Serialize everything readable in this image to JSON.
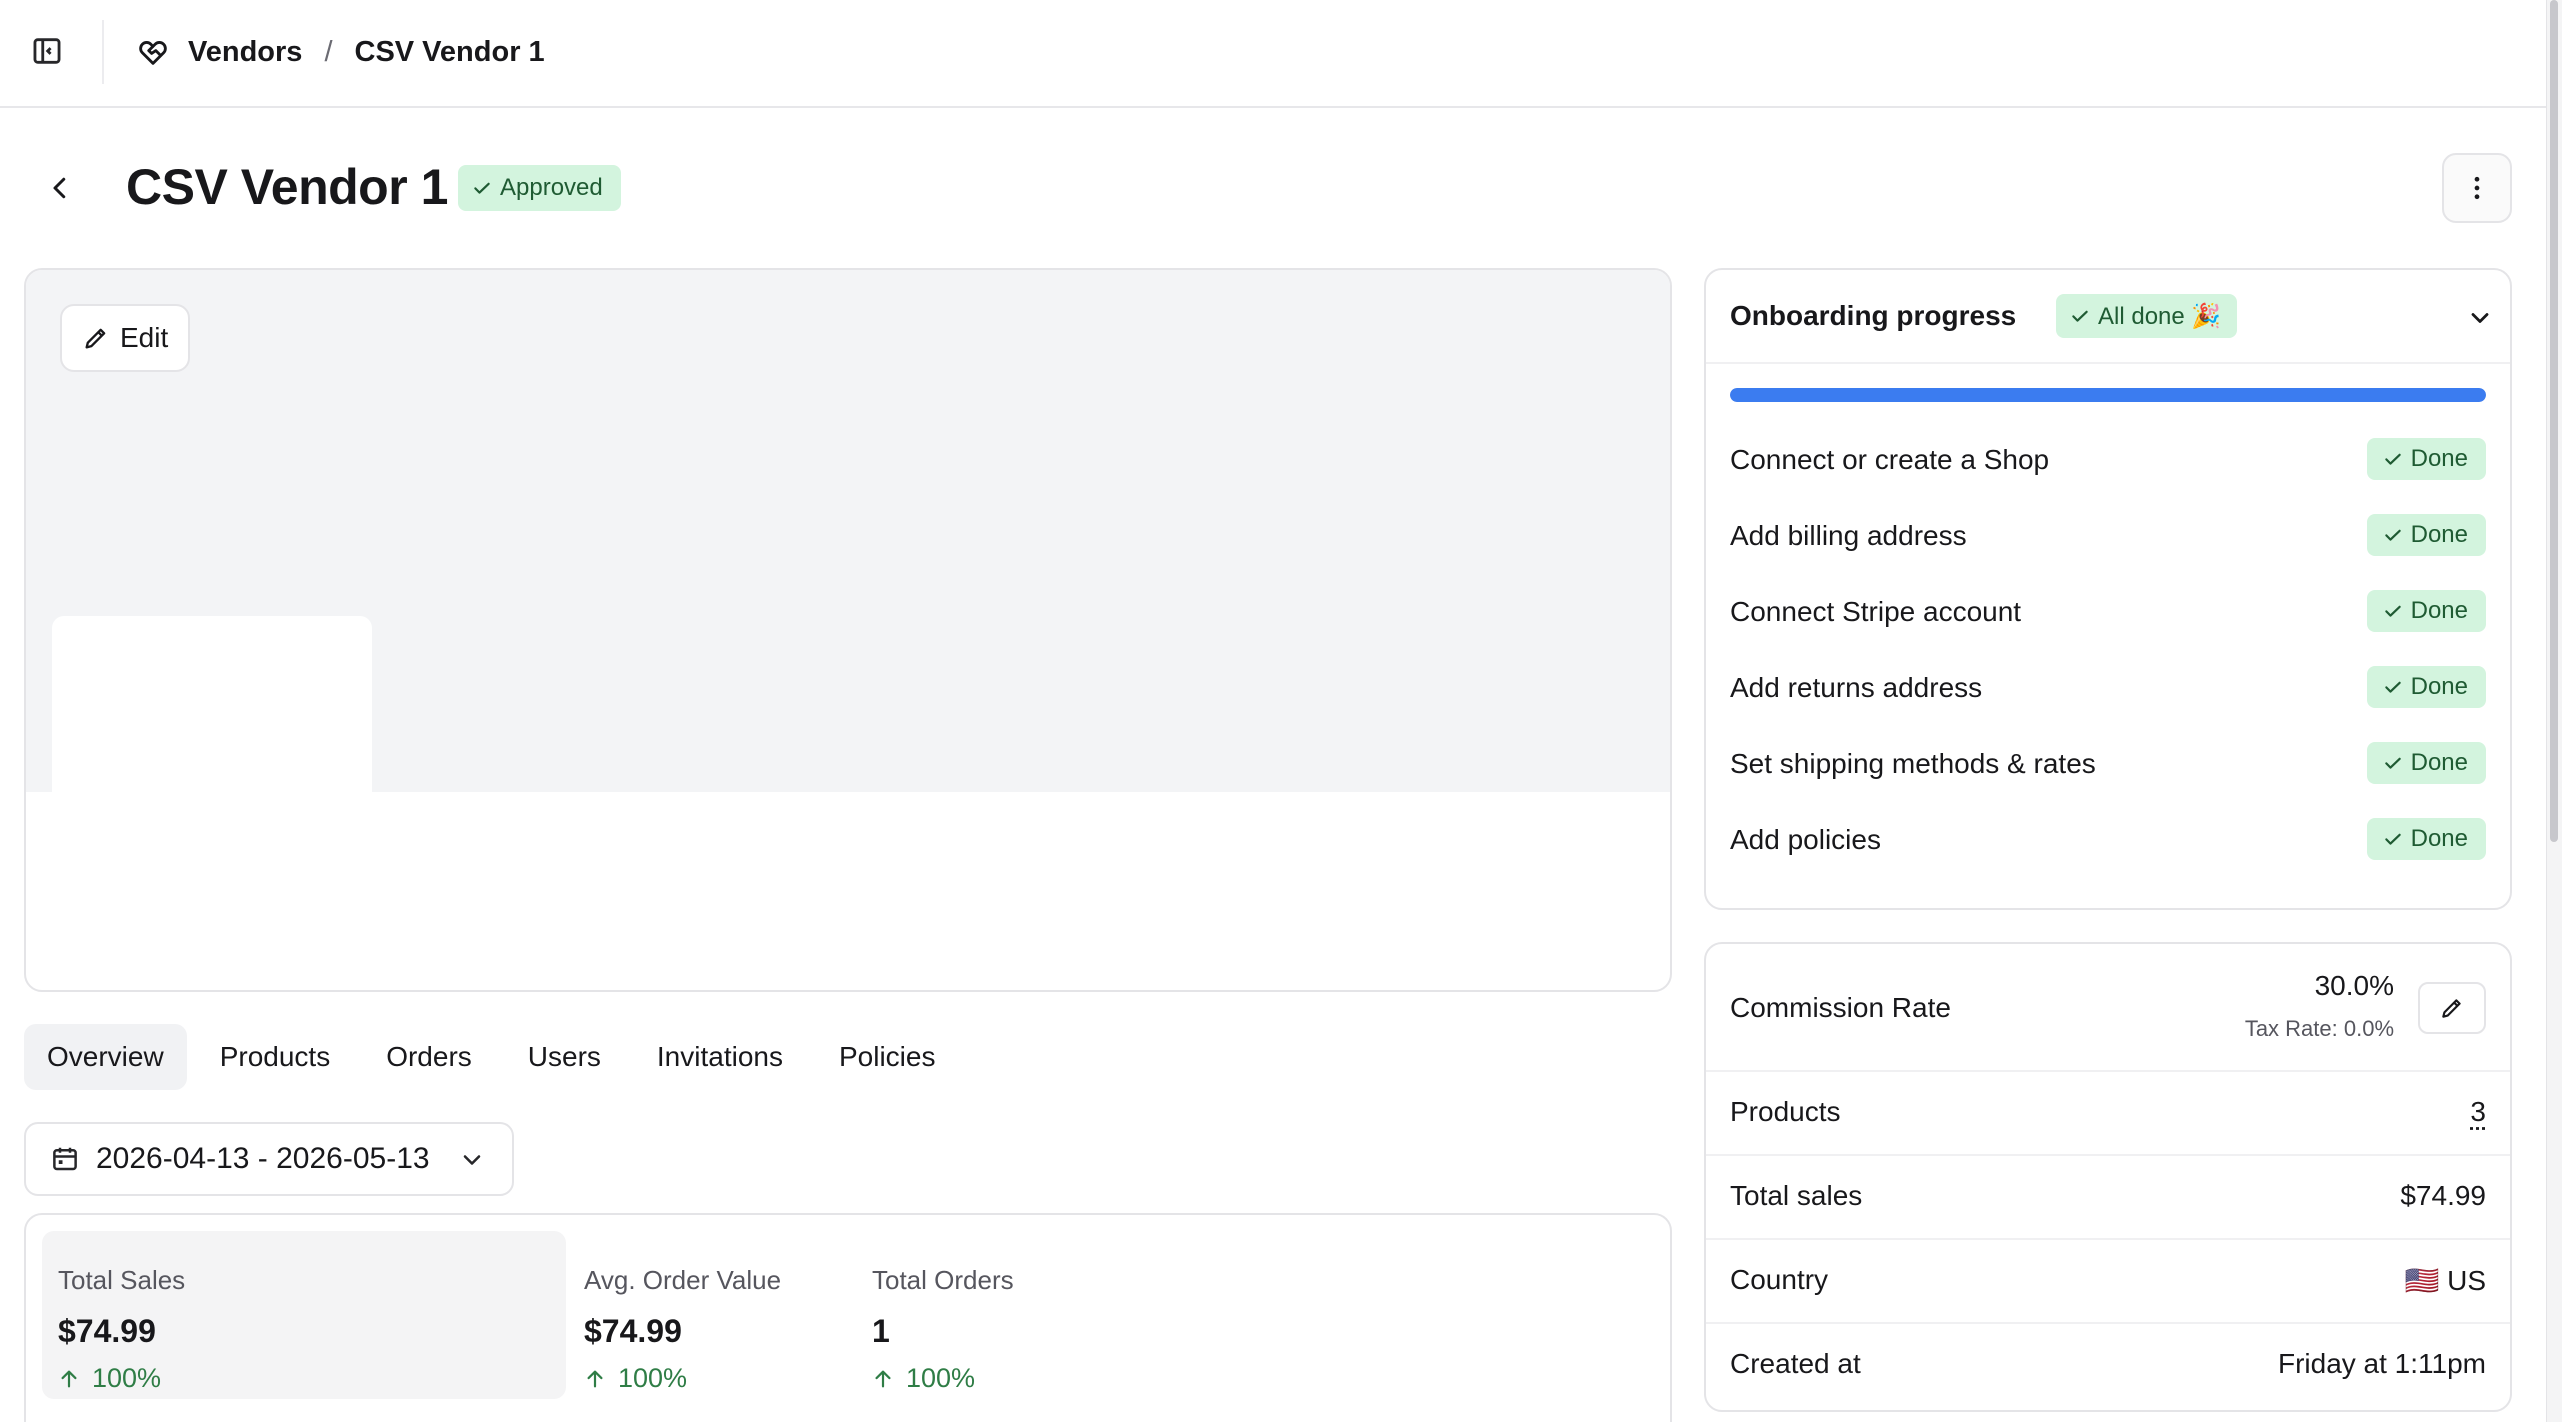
{
  "breadcrumb": {
    "items": [
      "Vendors",
      "CSV Vendor 1"
    ],
    "separator": "/"
  },
  "page": {
    "title": "CSV Vendor 1",
    "status": "Approved"
  },
  "banner": {
    "edit_label": "Edit"
  },
  "tabs": [
    {
      "label": "Overview",
      "active": true
    },
    {
      "label": "Products",
      "active": false
    },
    {
      "label": "Orders",
      "active": false
    },
    {
      "label": "Users",
      "active": false
    },
    {
      "label": "Invitations",
      "active": false
    },
    {
      "label": "Policies",
      "active": false
    }
  ],
  "date_range": {
    "value": "2026-04-13 - 2026-05-13"
  },
  "stats": [
    {
      "label": "Total Sales",
      "value": "$74.99",
      "change": "100%"
    },
    {
      "label": "Avg. Order Value",
      "value": "$74.99",
      "change": "100%"
    },
    {
      "label": "Total Orders",
      "value": "1",
      "change": "100%"
    }
  ],
  "onboarding": {
    "title": "Onboarding progress",
    "status": "All done 🎉",
    "progress": 1.0,
    "tasks": [
      {
        "label": "Connect or create a Shop",
        "status": "Done"
      },
      {
        "label": "Add billing address",
        "status": "Done"
      },
      {
        "label": "Connect Stripe account",
        "status": "Done"
      },
      {
        "label": "Add returns address",
        "status": "Done"
      },
      {
        "label": "Set shipping methods & rates",
        "status": "Done"
      },
      {
        "label": "Add policies",
        "status": "Done"
      }
    ]
  },
  "details": {
    "commission": {
      "label": "Commission Rate",
      "value": "30.0%",
      "tax_rate": "Tax Rate: 0.0%"
    },
    "products": {
      "label": "Products",
      "value": "3"
    },
    "total_sales": {
      "label": "Total sales",
      "value": "$74.99"
    },
    "country": {
      "label": "Country",
      "value": "🇺🇸 US"
    },
    "created_at": {
      "label": "Created at",
      "value": "Friday at 1:11pm"
    }
  },
  "colors": {
    "success_bg": "#d3f4de",
    "success_text": "#1f5b33",
    "progress": "#3b7cf0",
    "positive_change": "#2f7d46"
  }
}
